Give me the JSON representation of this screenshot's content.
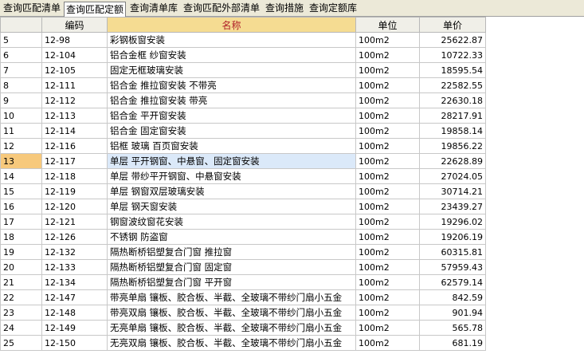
{
  "tabs": [
    {
      "label": "查询匹配清单",
      "active": false
    },
    {
      "label": "查询匹配定额",
      "active": true
    },
    {
      "label": "查询清单库",
      "active": false
    },
    {
      "label": "查询匹配外部清单",
      "active": false
    },
    {
      "label": "查询措施",
      "active": false
    },
    {
      "label": "查询定额库",
      "active": false
    }
  ],
  "table": {
    "headers": {
      "index": "",
      "code": "编码",
      "name": "名称",
      "unit": "单位",
      "price": "单价"
    },
    "selected_index": "13",
    "rows": [
      {
        "index": "5",
        "code": "12-98",
        "name": "彩钢板窗安装",
        "unit": "100m2",
        "price": "25622.87"
      },
      {
        "index": "6",
        "code": "12-104",
        "name": "铝合金框 纱窗安装",
        "unit": "100m2",
        "price": "10722.33"
      },
      {
        "index": "7",
        "code": "12-105",
        "name": "固定无框玻璃安装",
        "unit": "100m2",
        "price": "18595.54"
      },
      {
        "index": "8",
        "code": "12-111",
        "name": "铝合金 推拉窗安装 不带亮",
        "unit": "100m2",
        "price": "22582.55"
      },
      {
        "index": "9",
        "code": "12-112",
        "name": "铝合金 推拉窗安装 带亮",
        "unit": "100m2",
        "price": "22630.18"
      },
      {
        "index": "10",
        "code": "12-113",
        "name": "铝合金 平开窗安装",
        "unit": "100m2",
        "price": "28217.91"
      },
      {
        "index": "11",
        "code": "12-114",
        "name": "铝合金 固定窗安装",
        "unit": "100m2",
        "price": "19858.14"
      },
      {
        "index": "12",
        "code": "12-116",
        "name": "铝框 玻璃 百页窗安装",
        "unit": "100m2",
        "price": "19856.22"
      },
      {
        "index": "13",
        "code": "12-117",
        "name": "单层 平开钢窗、中悬窗、固定窗安装",
        "unit": "100m2",
        "price": "22628.89"
      },
      {
        "index": "14",
        "code": "12-118",
        "name": "单层 带纱平开钢窗、中悬窗安装",
        "unit": "100m2",
        "price": "27024.05"
      },
      {
        "index": "15",
        "code": "12-119",
        "name": "单层 钢窗双层玻璃安装",
        "unit": "100m2",
        "price": "30714.21"
      },
      {
        "index": "16",
        "code": "12-120",
        "name": "单层 钢天窗安装",
        "unit": "100m2",
        "price": "23439.27"
      },
      {
        "index": "17",
        "code": "12-121",
        "name": "钢窗波纹窗花安装",
        "unit": "100m2",
        "price": "19296.02"
      },
      {
        "index": "18",
        "code": "12-126",
        "name": "不锈钢 防盗窗",
        "unit": "100m2",
        "price": "19206.19"
      },
      {
        "index": "19",
        "code": "12-132",
        "name": "隔热断桥铝塑复合门窗 推拉窗",
        "unit": "100m2",
        "price": "60315.81"
      },
      {
        "index": "20",
        "code": "12-133",
        "name": "隔热断桥铝塑复合门窗 固定窗",
        "unit": "100m2",
        "price": "57959.43"
      },
      {
        "index": "21",
        "code": "12-134",
        "name": "隔热断桥铝塑复合门窗 平开窗",
        "unit": "100m2",
        "price": "62579.14"
      },
      {
        "index": "22",
        "code": "12-147",
        "name": "带亮单扇 镶板、胶合板、半截、全玻璃不带纱门扇小五金",
        "unit": "100m2",
        "price": "842.59"
      },
      {
        "index": "23",
        "code": "12-148",
        "name": "带亮双扇 镶板、胶合板、半截、全玻璃不带纱门扇小五金",
        "unit": "100m2",
        "price": "901.94"
      },
      {
        "index": "24",
        "code": "12-149",
        "name": "无亮单扇 镶板、胶合板、半截、全玻璃不带纱门扇小五金",
        "unit": "100m2",
        "price": "565.78"
      },
      {
        "index": "25",
        "code": "12-150",
        "name": "无亮双扇 镶板、胶合板、半截、全玻璃不带纱门扇小五金",
        "unit": "100m2",
        "price": "681.19"
      }
    ]
  }
}
